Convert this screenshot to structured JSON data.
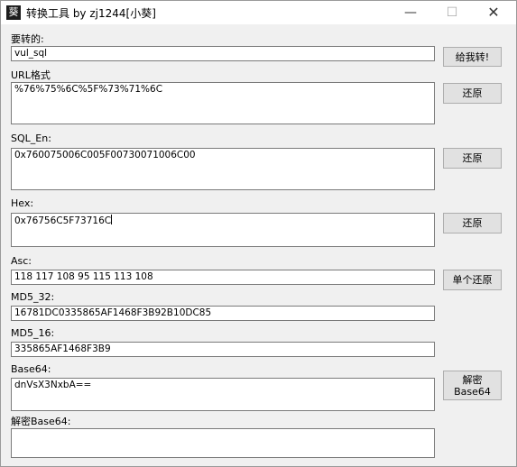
{
  "window": {
    "title": "转换工具 by zj1244[小葵]",
    "icon_glyph": "葵",
    "minimize": "—",
    "maximize": "☐",
    "close": "✕"
  },
  "fields": {
    "input_label": "要转的:",
    "input_value": "vul_sql",
    "url_label": "URL格式",
    "url_value": "%76%75%6C%5F%73%71%6C",
    "sqlen_label": "SQL_En:",
    "sqlen_value": "0x760075006C005F00730071006C00",
    "hex_label": "Hex:",
    "hex_value": "0x76756C5F73716C",
    "asc_label": "Asc:",
    "asc_value": "118 117 108 95 115 113 108",
    "md5_32_label": "MD5_32:",
    "md5_32_value": "16781DC0335865AF1468F3B92B10DC85",
    "md5_16_label": "MD5_16:",
    "md5_16_value": "335865AF1468F3B9",
    "base64_label": "Base64:",
    "base64_value": "dnVsX3NxbA==",
    "decode_base64_label": "解密Base64:",
    "decode_base64_value": ""
  },
  "buttons": {
    "convert": "给我转!",
    "restore_url": "还原",
    "restore_sqlen": "还原",
    "restore_hex": "还原",
    "single_restore": "单个还原",
    "decrypt_line1": "解密",
    "decrypt_line2": "Base64"
  }
}
